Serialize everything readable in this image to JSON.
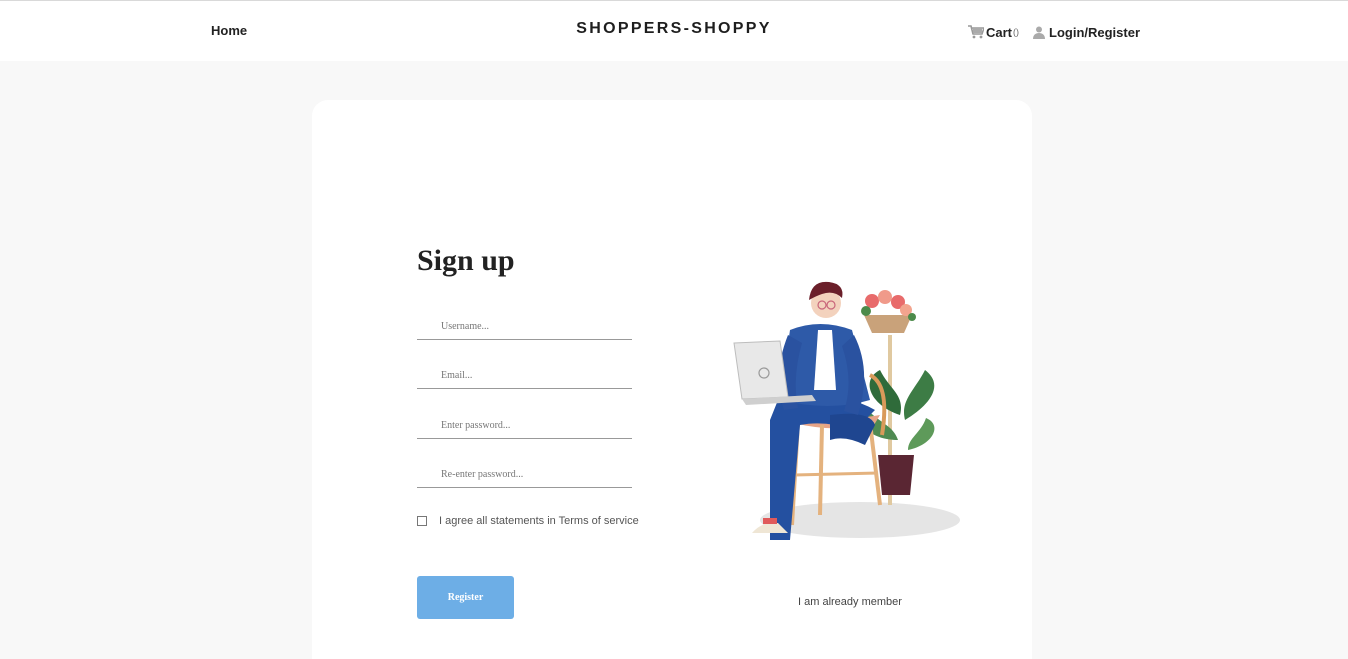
{
  "nav": {
    "home_label": "Home",
    "brand": "SHOPPERS-SHOPPY",
    "cart_label": "Cart",
    "cart_count": "()",
    "login_label": "Login/Register",
    "cart_icon": "cart-icon",
    "user_icon": "user-icon"
  },
  "form": {
    "title": "Sign up",
    "username_placeholder": "Username...",
    "email_placeholder": "Email...",
    "password_placeholder": "Enter password...",
    "reenter_placeholder": "Re-enter password...",
    "agree_label": "I agree all statements in Terms of service",
    "agree_checked": false,
    "register_label": "Register",
    "member_link": "I am already member"
  },
  "colors": {
    "page_bg": "#f8f8f8",
    "card_bg": "#ffffff",
    "button_bg": "#6daee6",
    "jacket": "#2e5aa8",
    "plant": "#2f6b3a"
  }
}
